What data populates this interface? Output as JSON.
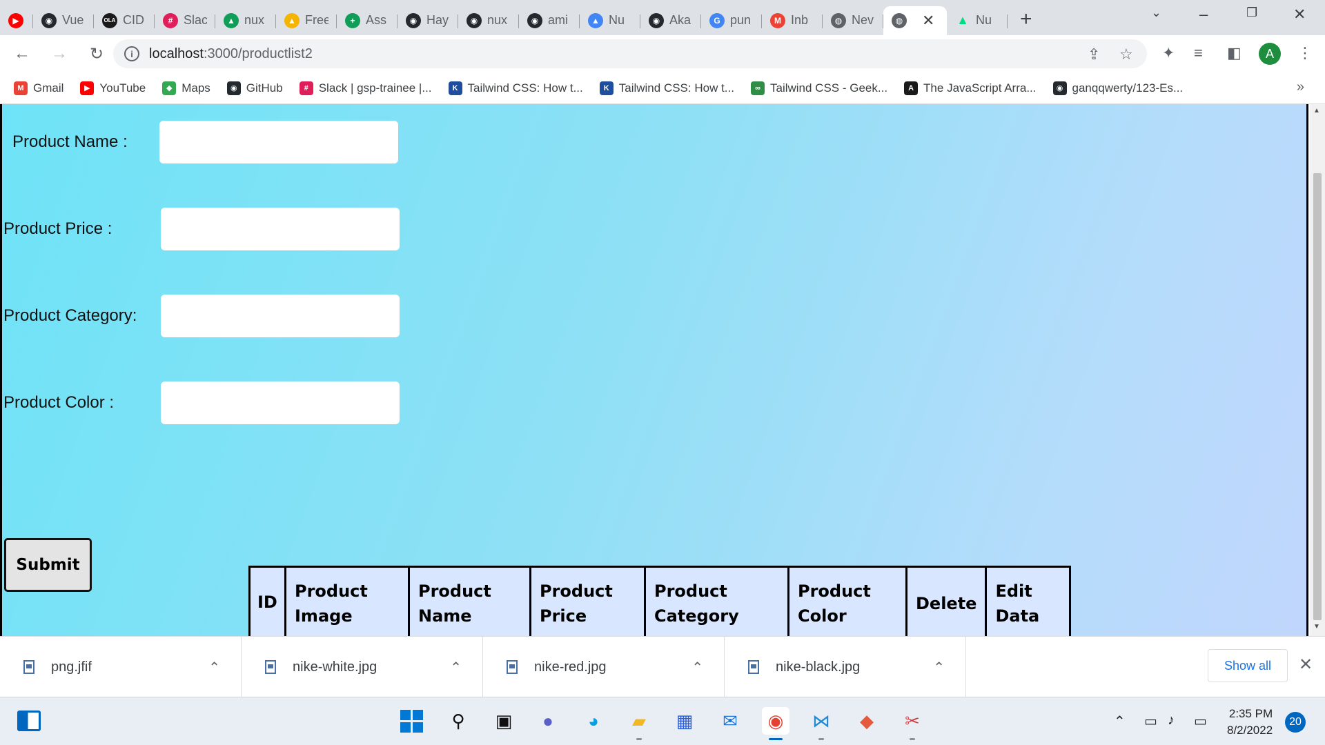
{
  "browser": {
    "tabs": [
      {
        "title": "",
        "icon": "youtube-icon",
        "color": "#ff0000",
        "glyph": "▶"
      },
      {
        "title": "Vue",
        "icon": "github-icon",
        "color": "#24292f",
        "glyph": "◉"
      },
      {
        "title": "CID",
        "icon": "ola-icon",
        "color": "#1a1a1a",
        "glyph": "OLA"
      },
      {
        "title": "Slac",
        "icon": "slack-icon",
        "color": "#e01e5a",
        "glyph": "#"
      },
      {
        "title": "nux",
        "icon": "drive-icon",
        "color": "#0f9d58",
        "glyph": "▲"
      },
      {
        "title": "Free",
        "icon": "drive-icon",
        "color": "#f4b400",
        "glyph": "▲"
      },
      {
        "title": "Ass",
        "icon": "sheets-icon",
        "color": "#0f9d58",
        "glyph": "+"
      },
      {
        "title": "Hay",
        "icon": "github-icon",
        "color": "#24292f",
        "glyph": "◉"
      },
      {
        "title": "nux",
        "icon": "github-icon",
        "color": "#24292f",
        "glyph": "◉"
      },
      {
        "title": "ami",
        "icon": "github-icon",
        "color": "#24292f",
        "glyph": "◉"
      },
      {
        "title": "Nu",
        "icon": "drive-icon",
        "color": "#4285f4",
        "glyph": "▲"
      },
      {
        "title": "Aka",
        "icon": "github-icon",
        "color": "#24292f",
        "glyph": "◉"
      },
      {
        "title": "pun",
        "icon": "google-icon",
        "color": "#4285f4",
        "glyph": "G"
      },
      {
        "title": "Inb",
        "icon": "gmail-icon",
        "color": "#ea4335",
        "glyph": "M"
      },
      {
        "title": "Nev",
        "icon": "globe-icon",
        "color": "#5f6368",
        "glyph": "◍"
      }
    ],
    "active_tab": {
      "title": "",
      "icon": "globe-icon"
    },
    "last_tab": {
      "title": "Nu",
      "icon": "nuxt-icon",
      "color": "#00dc82"
    },
    "url_host": "localhost",
    "url_path": ":3000/productlist2",
    "profile_initial": "A",
    "bookmarks": [
      {
        "label": "Gmail",
        "icon": "gmail-icon",
        "color": "#ea4335",
        "glyph": "M"
      },
      {
        "label": "YouTube",
        "icon": "youtube-icon",
        "color": "#ff0000",
        "glyph": "▶"
      },
      {
        "label": "Maps",
        "icon": "maps-icon",
        "color": "#34a853",
        "glyph": "◆"
      },
      {
        "label": "GitHub",
        "icon": "github-icon",
        "color": "#24292f",
        "glyph": "◉"
      },
      {
        "label": "Slack | gsp-trainee |...",
        "icon": "slack-icon",
        "color": "#e01e5a",
        "glyph": "#"
      },
      {
        "label": "Tailwind CSS: How t...",
        "icon": "k-icon",
        "color": "#1f4e9c",
        "glyph": "K"
      },
      {
        "label": "Tailwind CSS: How t...",
        "icon": "k-icon",
        "color": "#1f4e9c",
        "glyph": "K"
      },
      {
        "label": "Tailwind CSS - Geek...",
        "icon": "gfg-icon",
        "color": "#2f8d46",
        "glyph": "∞"
      },
      {
        "label": "The JavaScript Arra...",
        "icon": "js-icon",
        "color": "#1a1a1a",
        "glyph": "A"
      },
      {
        "label": "ganqqwerty/123-Es...",
        "icon": "github-icon",
        "color": "#24292f",
        "glyph": "◉"
      }
    ]
  },
  "form": {
    "fields": [
      {
        "label": "Product Name :",
        "value": ""
      },
      {
        "label": "Product Price :",
        "value": ""
      },
      {
        "label": "Product Category:",
        "value": ""
      },
      {
        "label": "Product Color :",
        "value": ""
      }
    ],
    "submit_label": "Submit"
  },
  "table": {
    "headers": [
      "ID",
      "Product\nImage",
      "Product\nName",
      "Product\nPrice",
      "Product\nCategory",
      "Product\nColor",
      "Delete",
      "Edit\nData"
    ]
  },
  "downloads": {
    "items": [
      "png.jfif",
      "nike-white.jpg",
      "nike-red.jpg",
      "nike-black.jpg"
    ],
    "show_all_label": "Show all"
  },
  "taskbar": {
    "time": "2:35 PM",
    "date": "8/2/2022",
    "notification_count": "20"
  }
}
